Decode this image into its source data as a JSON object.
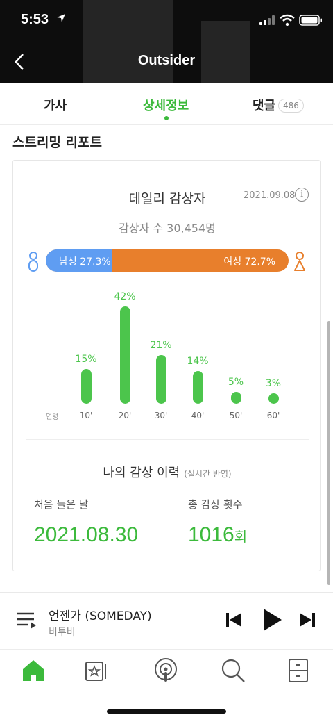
{
  "status_bar": {
    "time": "5:53"
  },
  "header": {
    "title": "Outsider"
  },
  "tabs": [
    {
      "label": "가사"
    },
    {
      "label": "상세정보"
    },
    {
      "label": "댓글"
    }
  ],
  "comment_count": "486",
  "section_title": "스트리밍 리포트",
  "daily": {
    "title": "데일리 감상자",
    "date": "2021.09.08",
    "info": "i",
    "listeners": "감상자 수 30,454명",
    "male_label": "남성 27.3%",
    "female_label": "여성 72.7%",
    "male_share": 27.3
  },
  "chart_data": {
    "type": "bar",
    "xlabel": "연령",
    "categories": [
      "10'",
      "20'",
      "30'",
      "40'",
      "50'",
      "60'"
    ],
    "values": [
      15,
      42,
      21,
      14,
      5,
      3
    ],
    "value_labels": [
      "15%",
      "42%",
      "21%",
      "14%",
      "5%",
      "3%"
    ],
    "ylim": [
      0,
      42
    ],
    "color": "#4cc54c"
  },
  "history": {
    "title": "나의 감상 이력",
    "subtitle": "(실시간 반영)",
    "first_label": "처음 들은 날",
    "first_value": "2021.08.30",
    "count_label": "총 감상 횟수",
    "count_value": "1016",
    "count_unit": "회"
  },
  "player": {
    "song": "언젠가 (SOMEDAY)",
    "artist": "비투비"
  },
  "colors": {
    "accent": "#3cba3c",
    "male": "#5f9df2",
    "female": "#e87f2c"
  },
  "icons": [
    "location-arrow-icon",
    "signal-icon",
    "wifi-icon",
    "battery-icon",
    "back-chevron-icon",
    "info-icon",
    "male-icon",
    "female-icon",
    "queue-icon",
    "prev-icon",
    "play-icon",
    "next-icon",
    "home-icon",
    "library-icon",
    "podcast-icon",
    "search-icon",
    "storage-icon"
  ]
}
